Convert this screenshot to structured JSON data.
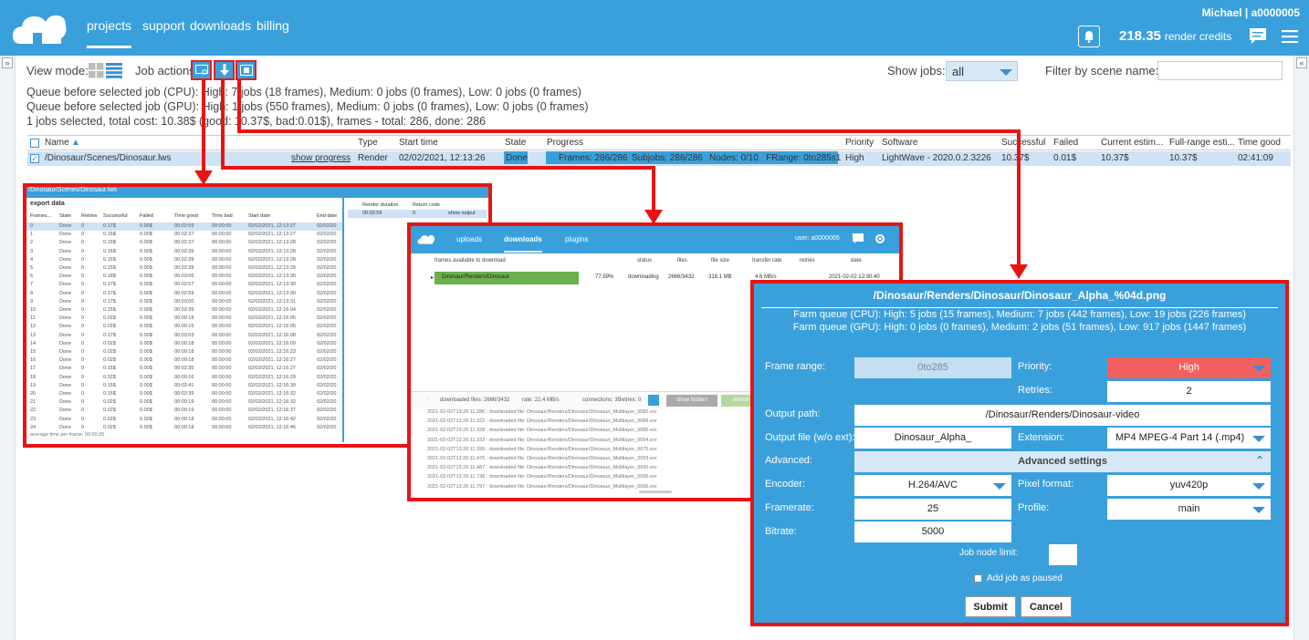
{
  "header": {
    "nav": [
      "projects",
      "support",
      "downloads",
      "billing"
    ],
    "user": "Michael | a0000005",
    "credits_value": "218.35",
    "credits_label": "render credits"
  },
  "toolbar": {
    "view_mode_label": "View mode:",
    "job_actions_label": "Job actions",
    "show_jobs_label": "Show jobs:",
    "show_jobs_value": "all",
    "filter_label": "Filter by scene name:"
  },
  "info": {
    "queue_cpu": "Queue before selected job (CPU): High: 7 jobs (18 frames), Medium: 0 jobs (0 frames), Low: 0 jobs (0 frames)",
    "queue_gpu": "Queue before selected job (GPU): High: 1 jobs (550 frames), Medium: 0 jobs (0 frames), Low: 0 jobs (0 frames)",
    "selected": "1 jobs selected, total cost: 10.38$ (good: 10.37$, bad:0.01$), frames - total: 286, done: 286"
  },
  "table": {
    "headers": [
      "Name",
      "Type",
      "Start time",
      "State",
      "Progress",
      "Priority",
      "Software",
      "Successful",
      "Failed",
      "Current estim...",
      "Full-range esti...",
      "Time good"
    ],
    "row": {
      "name": "/Dinosaur/Scenes/Dinosaur.lws",
      "show_progress": "show progress",
      "type": "Render",
      "start": "02/02/2021, 12:13:26",
      "state": "Done",
      "frames": "Frames: 286/286",
      "subjobs": "Subjobs: 286/286",
      "nodes": "Nodes: 0/10",
      "frange": "FRange: 0to285s1",
      "priority": "High",
      "software": "LightWave - 2020.0.2.3226",
      "successful": "10.37$",
      "failed": "0.01$",
      "current": "10.37$",
      "full": "10.37$",
      "timegood": "02:41:09"
    }
  },
  "export_window": {
    "title": "/Dinosaur/Scenes/Dinosaur.lws",
    "section": "export data",
    "cols": [
      "Frames...",
      "State",
      "Retries",
      "Successful",
      "Failed",
      "Time good",
      "Time bad",
      "Start date",
      "End date"
    ],
    "right_cols": [
      "Render duration",
      "Return code"
    ],
    "right_row": [
      "00:02:59",
      "0",
      "show output"
    ],
    "rows": [
      [
        "0",
        "Done",
        "0",
        "0.17$",
        "0.00$",
        "00:02:59",
        "00:00:00",
        "02/02/2021, 12:13:27",
        "02/02/20"
      ],
      [
        "1",
        "Done",
        "0",
        "0.15$",
        "0.00$",
        "00:02:37",
        "00:00:00",
        "02/02/2021, 12:13:27",
        "02/02/20"
      ],
      [
        "2",
        "Done",
        "0",
        "0.15$",
        "0.00$",
        "00:02:37",
        "00:00:00",
        "02/02/2021, 12:13:28",
        "02/02/20"
      ],
      [
        "3",
        "Done",
        "0",
        "0.15$",
        "0.00$",
        "00:02:35",
        "00:00:00",
        "02/02/2021, 12:13:28",
        "02/02/20"
      ],
      [
        "4",
        "Done",
        "0",
        "0.15$",
        "0.00$",
        "00:02:39",
        "00:00:00",
        "02/02/2021, 12:13:28",
        "02/02/20"
      ],
      [
        "5",
        "Done",
        "0",
        "0.15$",
        "0.00$",
        "00:02:39",
        "00:00:00",
        "02/02/2021, 12:13:29",
        "02/02/20"
      ],
      [
        "6",
        "Done",
        "0",
        "0.18$",
        "0.00$",
        "00:03:06",
        "00:00:00",
        "02/02/2021, 12:13:30",
        "02/02/20"
      ],
      [
        "7",
        "Done",
        "0",
        "0.17$",
        "0.00$",
        "00:02:57",
        "00:00:00",
        "02/02/2021, 12:13:30",
        "02/02/20"
      ],
      [
        "8",
        "Done",
        "0",
        "0.17$",
        "0.00$",
        "00:02:59",
        "00:00:00",
        "02/02/2021, 12:13:30",
        "02/02/20"
      ],
      [
        "9",
        "Done",
        "0",
        "0.17$",
        "0.00$",
        "00:03:00",
        "00:00:00",
        "02/02/2021, 12:13:31",
        "02/02/20"
      ],
      [
        "10",
        "Done",
        "0",
        "0.15$",
        "0.00$",
        "00:02:39",
        "00:00:00",
        "02/02/2021, 12:16:04",
        "02/02/20"
      ],
      [
        "11",
        "Done",
        "0",
        "0.02$",
        "0.00$",
        "00:00:18",
        "00:00:00",
        "02/02/2021, 12:16:05",
        "02/02/20"
      ],
      [
        "12",
        "Done",
        "0",
        "0.02$",
        "0.00$",
        "00:00:16",
        "00:00:00",
        "02/02/2021, 12:16:05",
        "02/02/20"
      ],
      [
        "13",
        "Done",
        "0",
        "0.17$",
        "0.00$",
        "00:03:03",
        "00:00:00",
        "02/02/2021, 12:16:08",
        "02/02/20"
      ],
      [
        "14",
        "Done",
        "0",
        "0.02$",
        "0.00$",
        "00:00:18",
        "00:00:00",
        "02/02/2021, 12:16:09",
        "02/02/20"
      ],
      [
        "15",
        "Done",
        "0",
        "0.02$",
        "0.00$",
        "00:00:18",
        "00:00:00",
        "02/02/2021, 12:16:23",
        "02/02/20"
      ],
      [
        "16",
        "Done",
        "0",
        "0.02$",
        "0.00$",
        "00:00:18",
        "00:00:00",
        "02/02/2021, 12:16:27",
        "02/02/20"
      ],
      [
        "17",
        "Done",
        "0",
        "0.15$",
        "0.00$",
        "00:02:35",
        "00:00:00",
        "02/02/2021, 12:16:27",
        "02/02/20"
      ],
      [
        "18",
        "Done",
        "0",
        "0.02$",
        "0.00$",
        "00:00:16",
        "00:00:00",
        "02/02/2021, 12:16:29",
        "02/02/20"
      ],
      [
        "19",
        "Done",
        "0",
        "0.15$",
        "0.00$",
        "00:02:41",
        "00:00:00",
        "02/02/2021, 12:16:30",
        "02/02/20"
      ],
      [
        "20",
        "Done",
        "0",
        "0.15$",
        "0.00$",
        "00:02:39",
        "00:00:00",
        "02/02/2021, 12:16:32",
        "02/02/20"
      ],
      [
        "21",
        "Done",
        "0",
        "0.02$",
        "0.00$",
        "00:00:19",
        "00:00:00",
        "02/02/2021, 12:16:32",
        "02/02/20"
      ],
      [
        "22",
        "Done",
        "0",
        "0.02$",
        "0.00$",
        "00:00:19",
        "00:00:00",
        "02/02/2021, 12:16:37",
        "02/02/20"
      ],
      [
        "23",
        "Done",
        "0",
        "0.02$",
        "0.00$",
        "00:00:18",
        "00:00:00",
        "02/02/2021, 12:16:42",
        "02/02/20"
      ],
      [
        "24",
        "Done",
        "0",
        "0.02$",
        "0.00$",
        "00:00:18",
        "00:00:00",
        "02/02/2021, 12:16:46",
        "02/02/20"
      ]
    ],
    "footer": "average time per frame: 00:00:35"
  },
  "downloader": {
    "tabs": [
      "uploads",
      "downloads",
      "plugins"
    ],
    "user": "user: a0000005",
    "cols": [
      "frames available to download",
      "status",
      "files",
      "file size",
      "transfer rate",
      "retries",
      "date"
    ],
    "row": {
      "name": "Dinosaur/Renders/Dinosaur",
      "pct": "77.59%",
      "status": "downloading",
      "files": "2666/3432",
      "size": "318.1 MB",
      "rate": "4.6 MB/s",
      "date": "2021-02-02 12:30:40"
    },
    "footer": {
      "files": "downloaded files: 2666/3432",
      "rate": "rate: 22.4 MB/s",
      "connections": "connections: 35",
      "retries": "retries: 0",
      "show_hidden": "show hidden",
      "refresh": "refresh"
    },
    "log": [
      "2021-02-02T13:26:11.286 : downloaded file: Dinosaur/Renders/Dinosaur/Dinosaur_Multilayer_0082.exr",
      "2021-02-02T13:26:11.322 : downloaded file: Dinosaur/Renders/Dinosaur/Dinosaur_Multilayer_0089.exr",
      "2021-02-02T13:26:11.328 : downloaded file: Dinosaur/Renders/Dinosaur/Dinosaur_Multilayer_0085.exr",
      "2021-02-02T13:26:11.333 : downloaded file: Dinosaur/Renders/Dinosaur/Dinosaur_Multilayer_0094.exr",
      "2021-02-02T13:26:11.399 : downloaded file: Dinosaur/Renders/Dinosaur/Dinosaur_Multilayer_0075.exr",
      "2021-02-02T13:26:11.476 : downloaded file: Dinosaur/Renders/Dinosaur/Dinosaur_Multilayer_0093.exr",
      "2021-02-02T13:26:11.487 : downloaded file: Dinosaur/Renders/Dinosaur/Dinosaur_Multilayer_0090.exr",
      "2021-02-02T13:26:11.738 : downloaded file: Dinosaur/Renders/Dinosaur/Dinosaur_Multilayer_0095.exr",
      "2021-02-02T13:26:11.797 : downloaded file: Dinosaur/Renders/Dinosaur/Dinosaur_Multilayer_0096.exr"
    ]
  },
  "dialog": {
    "title": "/Dinosaur/Renders/Dinosaur/Dinosaur_Alpha_%04d.png",
    "fq_cpu": "Farm queue (CPU): High: 5 jobs (15 frames), Medium: 7 jobs (442 frames), Low: 19 jobs (226 frames)",
    "fq_gpu": "Farm queue (GPU): High: 0 jobs (0 frames), Medium: 2 jobs (51 frames), Low: 917 jobs (1447 frames)",
    "frame_range_label": "Frame range:",
    "frame_range": "0to285",
    "priority_label": "Priority:",
    "priority": "High",
    "retries_label": "Retries:",
    "retries": "2",
    "output_path_label": "Output path:",
    "output_path": "/Dinosaur/Renders/Dinosaur-video",
    "output_file_label": "Output file (w/o ext):",
    "output_file": "Dinosaur_Alpha_",
    "extension_label": "Extension:",
    "extension": "MP4 MPEG-4 Part 14 (.mp4)",
    "advanced_label": "Advanced:",
    "advanced_settings": "Advanced settings",
    "encoder_label": "Encoder:",
    "encoder": "H.264/AVC",
    "pixel_label": "Pixel format:",
    "pixel": "yuv420p",
    "framerate_label": "Framerate:",
    "framerate": "25",
    "profile_label": "Profile:",
    "profile": "main",
    "bitrate_label": "Bitrate:",
    "bitrate": "5000",
    "node_limit_label": "Job node limit:",
    "paused_label": "Add job as paused",
    "submit": "Submit",
    "cancel": "Cancel"
  },
  "colors": {
    "brand": "#3aa0dc",
    "highlight": "#e81414",
    "priority_high": "#f26060",
    "download_bar": "#6ab04c"
  }
}
